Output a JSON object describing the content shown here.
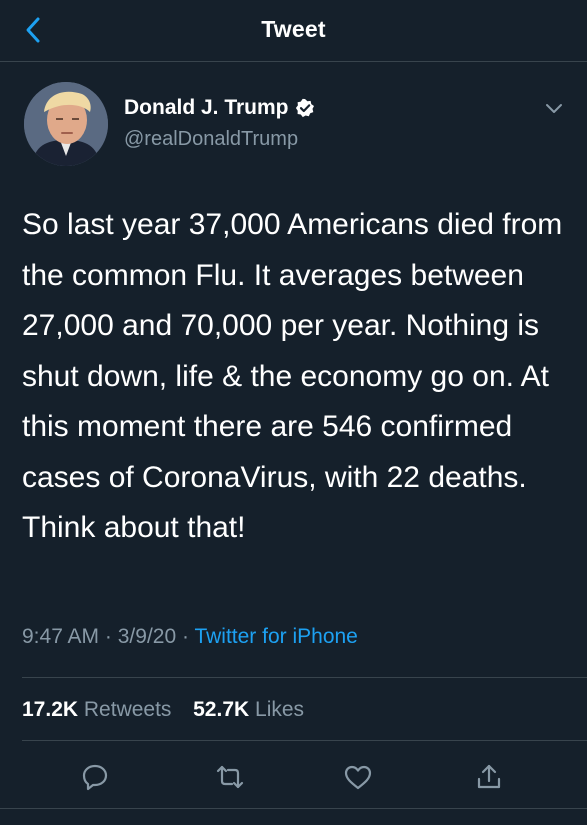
{
  "header": {
    "title": "Tweet",
    "back_icon": "chevron-left-icon"
  },
  "author": {
    "name": "Donald J. Trump",
    "handle": "@realDonaldTrump",
    "verified_icon": "verified-badge-icon"
  },
  "tweet": {
    "text": "So last year 37,000 Americans died from the common Flu. It averages between 27,000 and 70,000 per year. Nothing is shut down, life & the economy go on. At this moment there are 546 confirmed cases of CoronaVirus, with 22 deaths. Think about that!",
    "time": "9:47 AM",
    "date": "3/9/20",
    "separator": "·",
    "source": "Twitter for iPhone"
  },
  "stats": {
    "retweets_count": "17.2K",
    "retweets_label": "Retweets",
    "likes_count": "52.7K",
    "likes_label": "Likes"
  },
  "actions": [
    {
      "icon": "reply-icon"
    },
    {
      "icon": "retweet-icon"
    },
    {
      "icon": "like-icon"
    },
    {
      "icon": "share-icon"
    }
  ],
  "colors": {
    "background": "#15202b",
    "accent": "#1da1f2",
    "secondary_text": "#8899a6",
    "divider": "#38444d"
  }
}
